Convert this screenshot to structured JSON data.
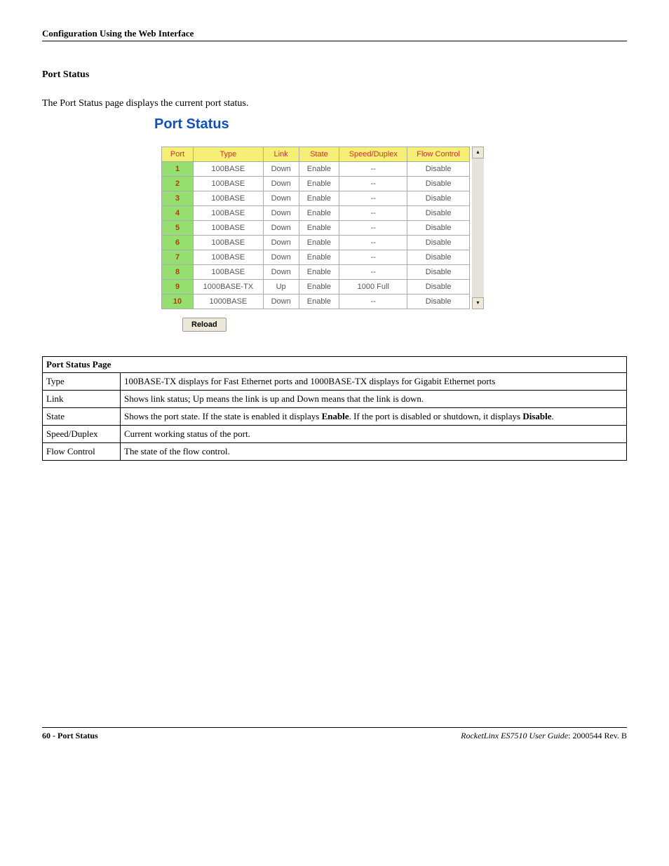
{
  "header": "Configuration Using the Web Interface",
  "section_title": "Port Status",
  "intro": "The Port Status page displays the current port status.",
  "widget_title": "Port Status",
  "reload_button": "Reload",
  "chart_data": {
    "type": "table",
    "columns": [
      "Port",
      "Type",
      "Link",
      "State",
      "Speed/Duplex",
      "Flow Control"
    ],
    "rows": [
      {
        "port": "1",
        "type": "100BASE",
        "link": "Down",
        "state": "Enable",
        "speed_duplex": "--",
        "flow_control": "Disable"
      },
      {
        "port": "2",
        "type": "100BASE",
        "link": "Down",
        "state": "Enable",
        "speed_duplex": "--",
        "flow_control": "Disable"
      },
      {
        "port": "3",
        "type": "100BASE",
        "link": "Down",
        "state": "Enable",
        "speed_duplex": "--",
        "flow_control": "Disable"
      },
      {
        "port": "4",
        "type": "100BASE",
        "link": "Down",
        "state": "Enable",
        "speed_duplex": "--",
        "flow_control": "Disable"
      },
      {
        "port": "5",
        "type": "100BASE",
        "link": "Down",
        "state": "Enable",
        "speed_duplex": "--",
        "flow_control": "Disable"
      },
      {
        "port": "6",
        "type": "100BASE",
        "link": "Down",
        "state": "Enable",
        "speed_duplex": "--",
        "flow_control": "Disable"
      },
      {
        "port": "7",
        "type": "100BASE",
        "link": "Down",
        "state": "Enable",
        "speed_duplex": "--",
        "flow_control": "Disable"
      },
      {
        "port": "8",
        "type": "100BASE",
        "link": "Down",
        "state": "Enable",
        "speed_duplex": "--",
        "flow_control": "Disable"
      },
      {
        "port": "9",
        "type": "1000BASE-TX",
        "link": "Up",
        "state": "Enable",
        "speed_duplex": "1000 Full",
        "flow_control": "Disable"
      },
      {
        "port": "10",
        "type": "1000BASE",
        "link": "Down",
        "state": "Enable",
        "speed_duplex": "--",
        "flow_control": "Disable"
      }
    ]
  },
  "desc_header": "Port Status Page",
  "desc_rows": [
    {
      "label": "Type",
      "text_before": "100BASE-TX displays for Fast Ethernet ports and 1000BASE-TX displays for Gigabit Ethernet ports",
      "bold1": "",
      "text_mid": "",
      "bold2": "",
      "text_after": ""
    },
    {
      "label": "Link",
      "text_before": "Shows link status; Up means the link is up and Down means that the link is down.",
      "bold1": "",
      "text_mid": "",
      "bold2": "",
      "text_after": ""
    },
    {
      "label": "State",
      "text_before": "Shows the port state. If the state is enabled it displays ",
      "bold1": "Enable",
      "text_mid": ". If the port is disabled or shutdown, it displays ",
      "bold2": "Disable",
      "text_after": "."
    },
    {
      "label": "Speed/Duplex",
      "text_before": "Current working status of the port.",
      "bold1": "",
      "text_mid": "",
      "bold2": "",
      "text_after": ""
    },
    {
      "label": "Flow Control",
      "text_before": "The state of the flow control.",
      "bold1": "",
      "text_mid": "",
      "bold2": "",
      "text_after": ""
    }
  ],
  "footer": {
    "left": "60 - Port Status",
    "right_italic": "RocketLinx ES7510  User Guide",
    "right_normal": ": 2000544 Rev. B"
  }
}
